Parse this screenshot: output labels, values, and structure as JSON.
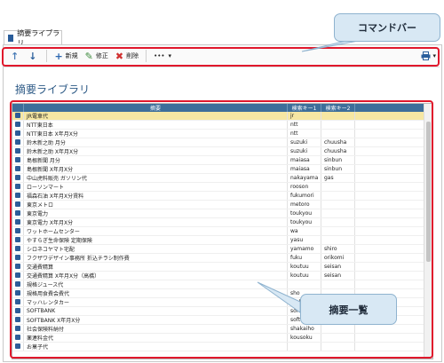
{
  "tab": {
    "title": "摘要ライブラリ"
  },
  "toolbar": {
    "up_icon": "↑",
    "down_icon": "↓",
    "new_label": "新規",
    "edit_label": "修正",
    "delete_label": "削除",
    "more_label": "•••",
    "printer_icon": "printer-icon"
  },
  "page": {
    "title": "摘要ライブラリ"
  },
  "table": {
    "headers": [
      "摘要",
      "検索キー1",
      "検索キー2"
    ],
    "rows": [
      [
        "JR電車代",
        "jr",
        ""
      ],
      [
        "NTT東日本",
        "ntt",
        ""
      ],
      [
        "NTT東日本 X年月X分",
        "ntt",
        ""
      ],
      [
        "鈴木新之助 月分",
        "suzuki",
        "chuusha"
      ],
      [
        "鈴木新之助 X年月X分",
        "suzuki",
        "chuusha"
      ],
      [
        "島根新聞 月分",
        "maiasa",
        "sinbun"
      ],
      [
        "島根新聞 X年月X分",
        "maiasa",
        "sinbun"
      ],
      [
        "中山虎料販売 ガソリン代",
        "nakayama",
        "gas"
      ],
      [
        "ローソンマート",
        "rooson",
        ""
      ],
      [
        "福森石油 X年月X分賃料",
        "fukumori",
        ""
      ],
      [
        "東京メトロ",
        "metoro",
        ""
      ],
      [
        "東京電力",
        "toukyou",
        ""
      ],
      [
        "東京電力 X年月X分",
        "toukyou",
        ""
      ],
      [
        "ワットホームセンター",
        "wa",
        ""
      ],
      [
        "やすらぎ生命保険 定期保険",
        "yasu",
        ""
      ],
      [
        "シロネコヤマト宅配",
        "yamamo",
        "shiro"
      ],
      [
        "フクザワデザイン事務所 折込チラシ制作費",
        "fuku",
        "orikomi"
      ],
      [
        "交通費精算",
        "koutuu",
        "seisan"
      ],
      [
        "交通費精算 X年月X分（高橋）",
        "koutuu",
        "seisan"
      ],
      [
        "規格ジュース代",
        "",
        ""
      ],
      [
        "規格用食費会費代",
        "sho",
        ""
      ],
      [
        "マッハレンタカー",
        "mahha",
        ""
      ],
      [
        "SOFTBANK",
        "soft",
        ""
      ],
      [
        "SOFTBANK X年月X分",
        "soft",
        ""
      ],
      [
        "社会保険料納付",
        "shakaiho",
        ""
      ],
      [
        "薬連料金代",
        "kousoku",
        ""
      ],
      [
        "お菓子代",
        "",
        ""
      ]
    ]
  },
  "callouts": {
    "command_bar": "コマンドバー",
    "summary_list": "摘要一覧"
  },
  "colors": {
    "accent": "#3d6e9a",
    "highlight": "#e0182c",
    "selected_row": "#f6e7a3"
  }
}
